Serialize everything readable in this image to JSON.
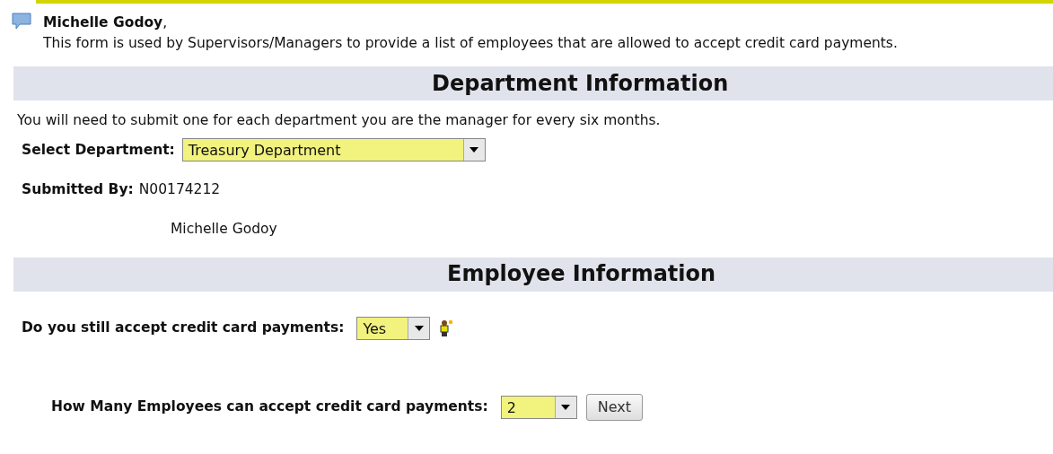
{
  "greeting": {
    "name": "Michelle Godoy",
    "suffix": ",",
    "message": "This form is used by Supervisors/Managers to provide a list of employees that are allowed to accept credit card payments."
  },
  "department_section": {
    "title": "Department Information",
    "note": "You will need to submit one for each department you are the manager for every six months.",
    "department": {
      "label": "Select Department:",
      "value": "Treasury Department"
    },
    "submitted_by": {
      "label": "Submitted By:",
      "id": "N00174212",
      "name": "Michelle Godoy"
    }
  },
  "employee_section": {
    "title": "Employee Information",
    "accept_cards": {
      "label": "Do you still accept credit card payments:",
      "value": "Yes"
    },
    "employee_count": {
      "label": "How Many Employees can accept credit card payments:",
      "value": "2"
    },
    "buttons": [
      "Next"
    ]
  }
}
